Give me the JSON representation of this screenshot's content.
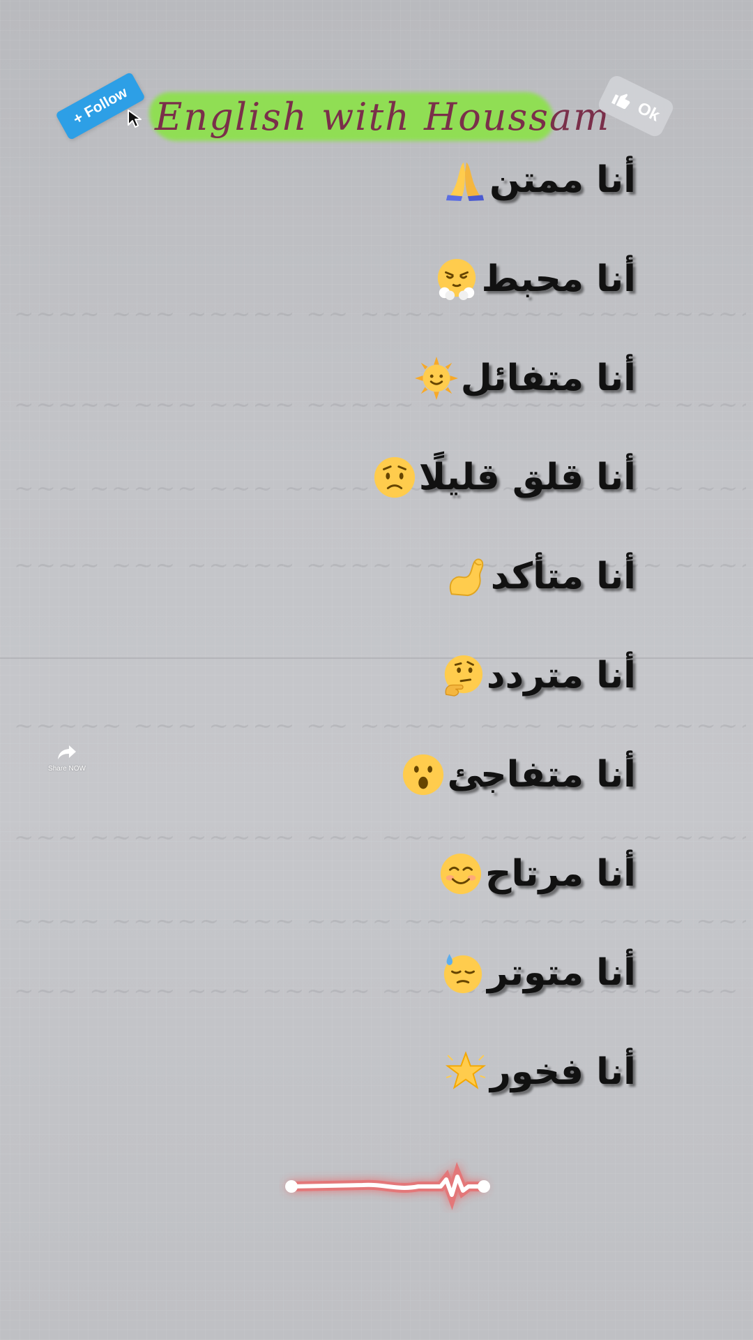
{
  "header": {
    "follow_label": "Follow",
    "follow_plus": "+",
    "title": "English with Houssam",
    "ok_label": "Ok"
  },
  "phrases": [
    {
      "text": "أنا ممتن",
      "emoji": "folded-hands"
    },
    {
      "text": "أنا محبط",
      "emoji": "face-with-steam"
    },
    {
      "text": "أنا متفائل",
      "emoji": "sun-with-face"
    },
    {
      "text": "أنا قلق قليلًا",
      "emoji": "worried-face"
    },
    {
      "text": "أنا متأكد",
      "emoji": "flexed-biceps"
    },
    {
      "text": "أنا متردد",
      "emoji": "thinking-face"
    },
    {
      "text": "أنا متفاجئ",
      "emoji": "surprised-face"
    },
    {
      "text": "أنا مرتاح",
      "emoji": "smiling-face"
    },
    {
      "text": "أنا متوتر",
      "emoji": "downcast-face-with-sweat"
    },
    {
      "text": "أنا فخور",
      "emoji": "glowing-star"
    }
  ],
  "share": {
    "label": "Share NOW"
  },
  "colors": {
    "follow_bg": "#2d9fe6",
    "title_highlight": "#8ee04f",
    "title_ink": "#7a2f4a",
    "waveform_glow": "#ff3b3b"
  }
}
